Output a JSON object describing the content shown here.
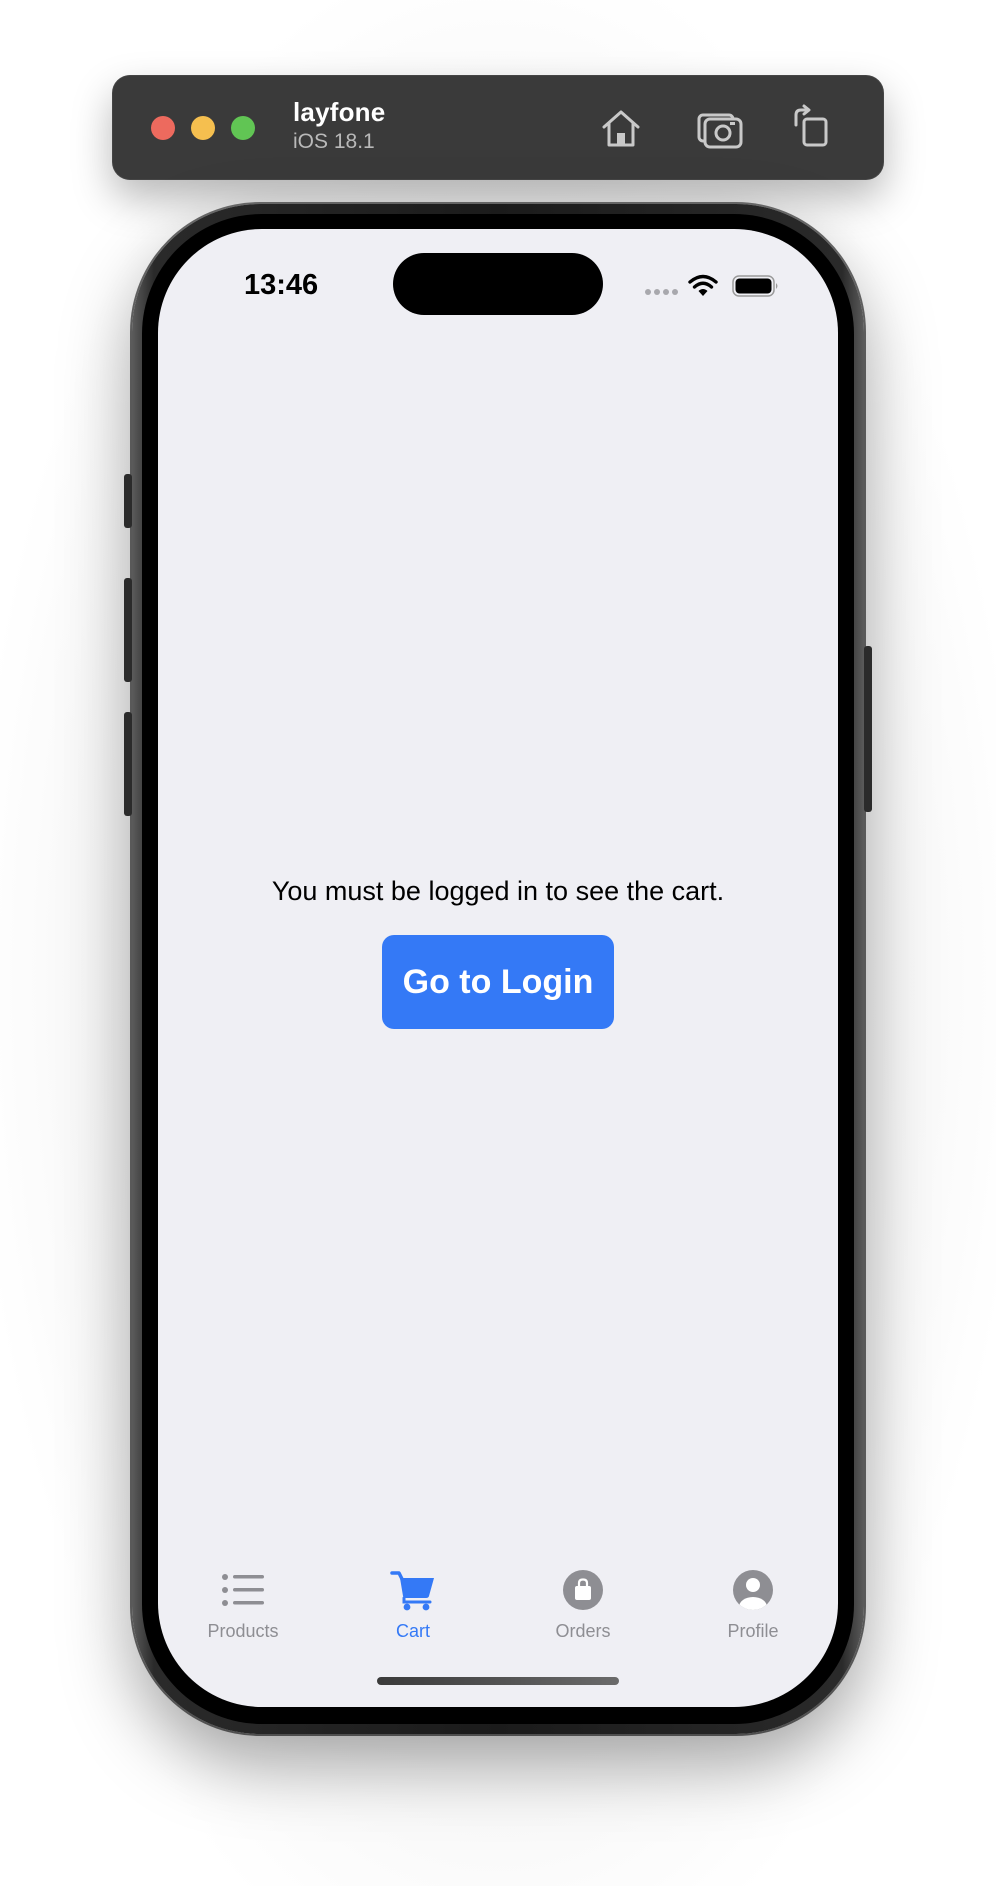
{
  "simulator": {
    "device_name": "layfone",
    "os_version": "iOS 18.1",
    "toolbar_icons": [
      "home-icon",
      "screenshot-icon",
      "rotate-icon"
    ]
  },
  "status_bar": {
    "time": "13:46",
    "icons": [
      "cellular-dots-icon",
      "wifi-icon",
      "battery-icon"
    ]
  },
  "main": {
    "message": "You must be logged in to see the cart.",
    "login_button_label": "Go to Login"
  },
  "tab_bar": {
    "items": [
      {
        "label": "Products",
        "icon": "list-icon",
        "active": false
      },
      {
        "label": "Cart",
        "icon": "cart-icon",
        "active": true
      },
      {
        "label": "Orders",
        "icon": "bag-icon",
        "active": false
      },
      {
        "label": "Profile",
        "icon": "person-circle-icon",
        "active": false
      }
    ]
  },
  "colors": {
    "accent": "#3479f6",
    "inactive_tab": "#8e8e93",
    "screen_background": "#efeff4",
    "toolbar_background": "#3a3a3a"
  }
}
